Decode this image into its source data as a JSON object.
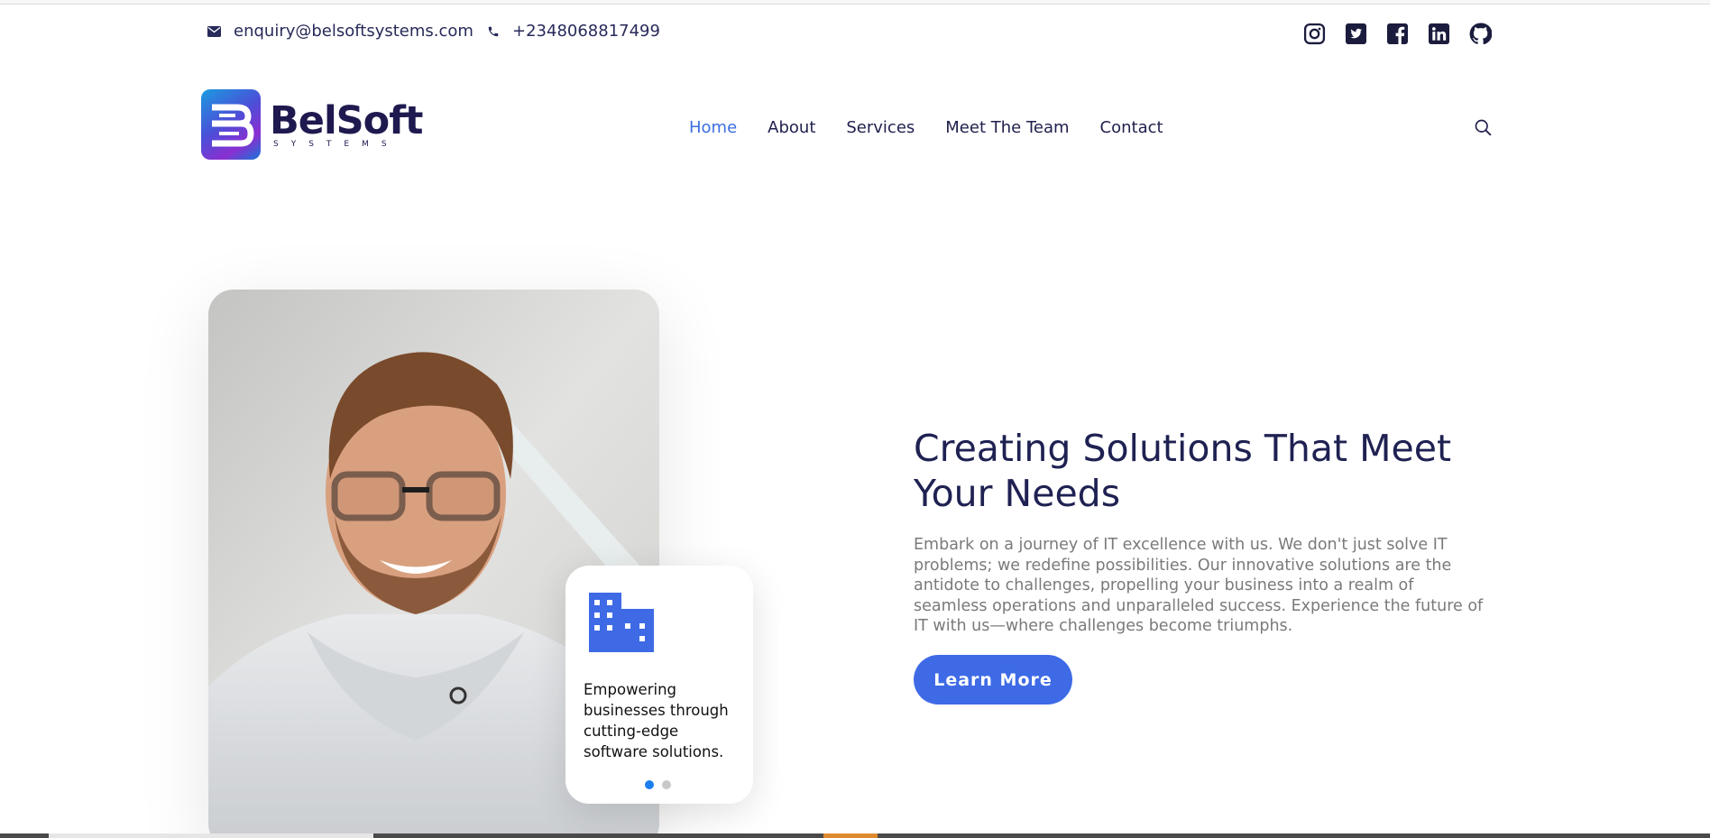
{
  "topbar": {
    "email": "enquiry@belsoftsystems.com",
    "phone": "+2348068817499",
    "social": [
      "instagram-icon",
      "twitter-icon",
      "facebook-icon",
      "linkedin-icon",
      "github-icon"
    ]
  },
  "brand": {
    "name": "BelSoft",
    "tagline": "SYSTEMS"
  },
  "nav": {
    "items": [
      "Home",
      "About",
      "Services",
      "Meet The Team",
      "Contact"
    ],
    "active": "Home"
  },
  "hero": {
    "title": "Creating Solutions That Meet Your Needs",
    "description": "Embark on a journey of IT excellence with us. We don't just solve IT problems; we redefine possibilities. Our innovative solutions are the antidote to challenges, propelling your business into a realm of seamless operations and unparalleled success. Experience the future of IT with us—where challenges become triumphs.",
    "button": "Learn More"
  },
  "info_card": {
    "icon": "building-icon",
    "text": "Empowering businesses through cutting-edge software solutions."
  },
  "slider": {
    "total": 2,
    "active": 1
  },
  "colors": {
    "accent": "#3e6ae6",
    "nav_active": "#3b6fe0",
    "heading": "#1f2152",
    "body_text": "#7a7a7a",
    "dot_active": "#1c7ff0"
  }
}
